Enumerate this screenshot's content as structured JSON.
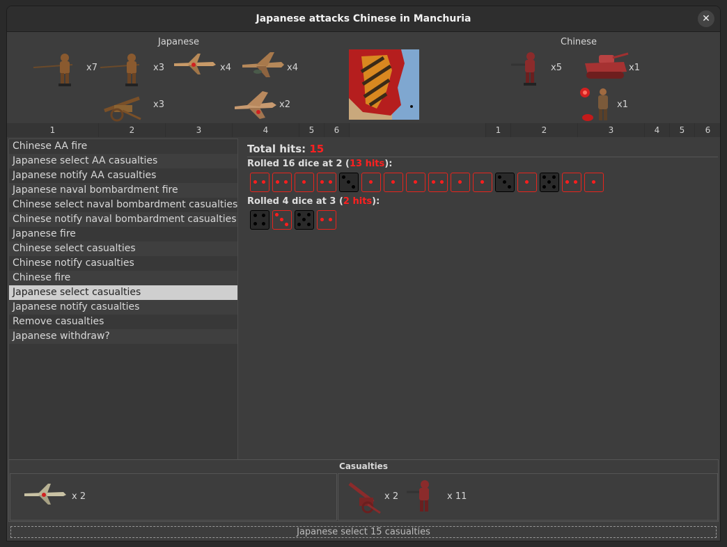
{
  "window": {
    "title": "Japanese attacks Chinese in Manchuria",
    "close_icon": "close-icon"
  },
  "attacker": {
    "name": "Japanese",
    "units": [
      {
        "icon": "infantry-icon",
        "count": "x7"
      },
      {
        "icon": "infantry-icon",
        "count": "x3"
      },
      {
        "icon": "fighter-icon",
        "count": "x4"
      },
      {
        "icon": "tactical-bomber-icon",
        "count": "x4"
      },
      {
        "icon": "artillery-icon",
        "count": "x3"
      },
      {
        "icon": "bomber-icon",
        "count": "x2"
      }
    ]
  },
  "defender": {
    "name": "Chinese",
    "units": [
      {
        "icon": "infantry-icon",
        "count": "x5"
      },
      {
        "icon": "tank-icon",
        "count": "x1"
      },
      {
        "icon": "officer-icon",
        "count": "x1"
      }
    ]
  },
  "ruler": {
    "attacker_numbers": [
      "1",
      "2",
      "3",
      "4",
      "5",
      "6"
    ],
    "defender_numbers": [
      "1",
      "2",
      "3",
      "4",
      "5",
      "6"
    ]
  },
  "steps": [
    "Chinese AA fire",
    "Japanese select AA casualties",
    "Japanese notify AA casualties",
    "Japanese naval bombardment fire",
    "Chinese select naval bombardment casualties",
    "Chinese notify naval bombardment casualties",
    "Japanese fire",
    "Chinese select casualties",
    "Chinese notify casualties",
    "Chinese fire",
    "Japanese select casualties",
    "Japanese notify casualties",
    "Remove casualties",
    "Japanese withdraw?"
  ],
  "selected_step": 10,
  "dice": {
    "total_label": "Total hits:",
    "total_value": "15",
    "rolls": [
      {
        "label_prefix": "Rolled 16 dice at 2 (",
        "hits_text": "13 hits",
        "label_suffix": "):",
        "values": [
          2,
          2,
          1,
          2,
          3,
          1,
          1,
          1,
          2,
          1,
          1,
          3,
          1,
          5,
          2,
          1
        ],
        "hit": [
          true,
          true,
          true,
          true,
          false,
          true,
          true,
          true,
          true,
          true,
          true,
          false,
          true,
          false,
          true,
          true
        ]
      },
      {
        "label_prefix": "Rolled 4 dice at 3 (",
        "hits_text": "2 hits",
        "label_suffix": "):",
        "values": [
          4,
          3,
          5,
          2
        ],
        "hit": [
          false,
          true,
          false,
          true
        ]
      }
    ]
  },
  "casualties": {
    "title": "Casualties",
    "left": [
      {
        "icon": "fighter-icon",
        "count": "x 2"
      }
    ],
    "right": [
      {
        "icon": "artillery-icon",
        "count": "x 2"
      },
      {
        "icon": "infantry-icon",
        "count": "x 11"
      }
    ]
  },
  "status_text": "Japanese select 15 casualties",
  "colors": {
    "hit_red": "#ff2020",
    "selected_bg": "#cfcfcf",
    "japanese_unit": "#8a5a2f",
    "chinese_unit": "#8b2b2b"
  }
}
